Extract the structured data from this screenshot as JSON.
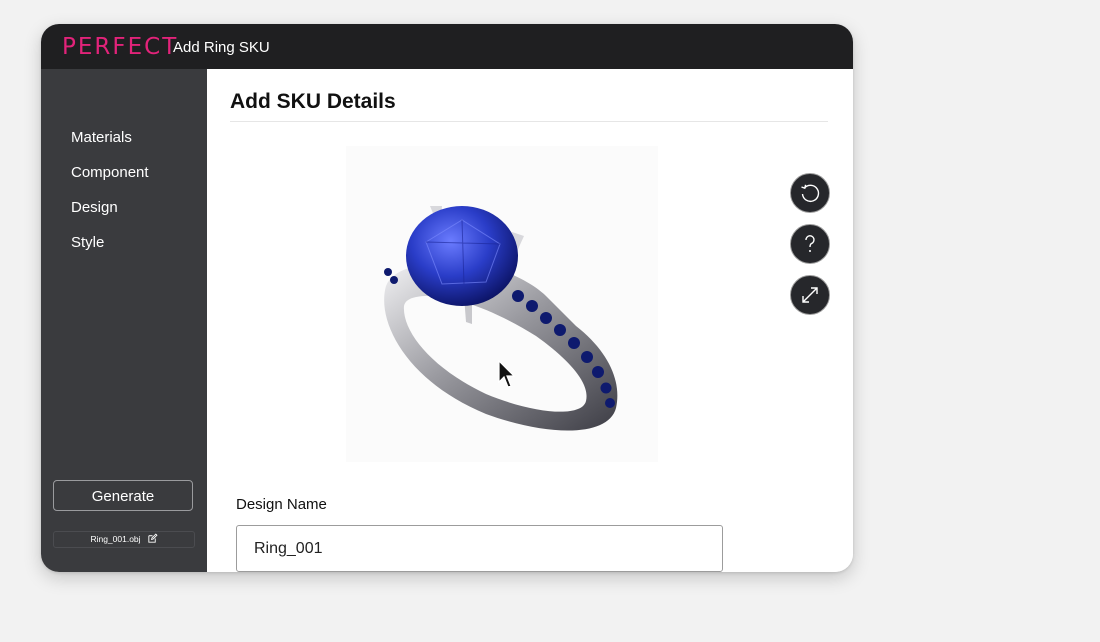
{
  "app": {
    "brand": "PERFECT",
    "window_title": "Add Ring SKU",
    "brand_color": "#e2237a"
  },
  "sidebar": {
    "items": [
      {
        "label": "Materials"
      },
      {
        "label": "Component"
      },
      {
        "label": "Design"
      },
      {
        "label": "Style"
      }
    ],
    "generate_label": "Generate",
    "file_name": "Ring_001.obj",
    "file_edit_icon": "edit-icon"
  },
  "main": {
    "heading": "Add SKU Details",
    "preview_alt": "3D ring preview",
    "tools": [
      {
        "icon": "rotate-icon"
      },
      {
        "icon": "help-icon"
      },
      {
        "icon": "expand-icon"
      }
    ],
    "design_name_label": "Design Name",
    "design_name_value": "Ring_001",
    "design_name_placeholder": ""
  }
}
